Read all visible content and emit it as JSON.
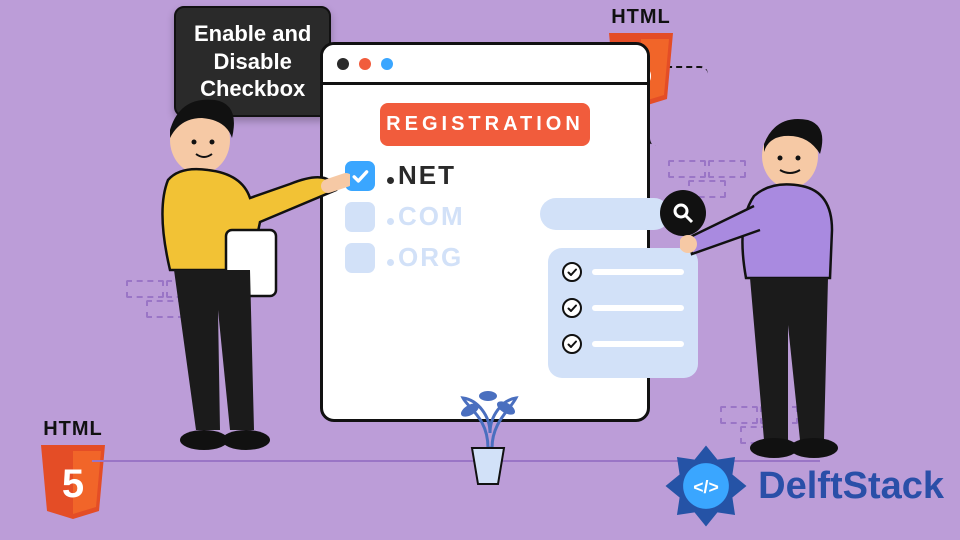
{
  "tooltip": {
    "line1": "Enable and",
    "line2": "Disable",
    "line3": "Checkbox"
  },
  "html5": {
    "label": "HTML",
    "version": "5"
  },
  "window": {
    "button_label": "REGISTRATION",
    "domains": [
      {
        "tld": "NET",
        "checked": true
      },
      {
        "tld": "COM",
        "checked": false
      },
      {
        "tld": "ORG",
        "checked": false
      }
    ]
  },
  "panel": {
    "rows": 3
  },
  "brand": {
    "name": "DelftStack"
  }
}
